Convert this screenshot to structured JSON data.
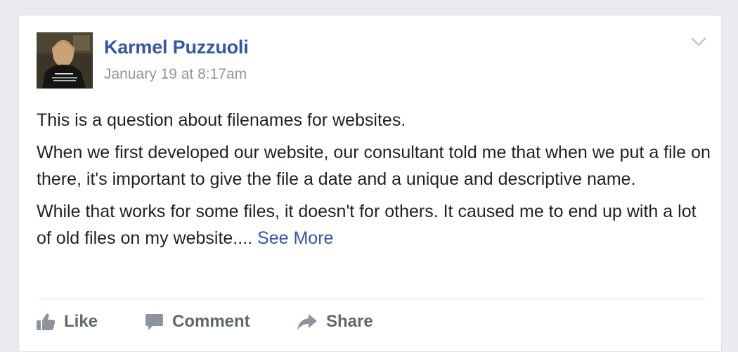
{
  "post": {
    "author": "Karmel Puzzuoli",
    "timestamp": "January 19 at 8:17am",
    "paragraphs": [
      "This is a question about filenames for websites.",
      "When we first developed our website, our consultant told me that when we put a file on there, it's important to give the file a date and a unique and descriptive name.",
      "While that works for some files, it doesn't for others. It caused me to end up with a lot of old files on my website...."
    ],
    "see_more": "See More",
    "menu_icon": "chevron-down-icon",
    "avatar_icon": "profile-photo"
  },
  "actions": {
    "like": {
      "label": "Like",
      "icon": "thumbs-up-icon"
    },
    "comment": {
      "label": "Comment",
      "icon": "comment-bubble-icon"
    },
    "share": {
      "label": "Share",
      "icon": "share-arrow-icon"
    }
  },
  "colors": {
    "page_bg": "#e9ebee",
    "card_bg": "#ffffff",
    "link": "#365899",
    "text": "#1d2129",
    "meta": "#90949c",
    "action": "#606770"
  }
}
